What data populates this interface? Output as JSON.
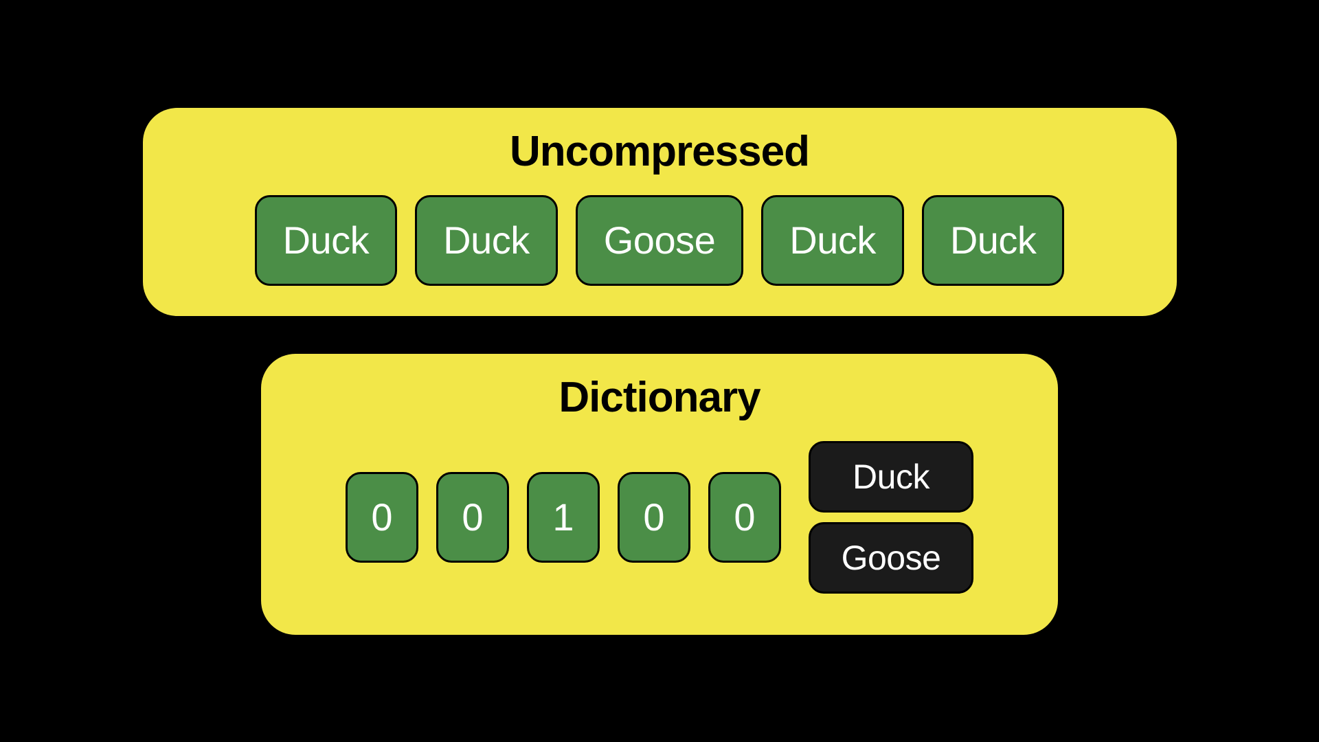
{
  "uncompressed": {
    "title": "Uncompressed",
    "items": [
      "Duck",
      "Duck",
      "Goose",
      "Duck",
      "Duck"
    ]
  },
  "dictionary": {
    "title": "Dictionary",
    "codes": [
      "0",
      "0",
      "1",
      "0",
      "0"
    ],
    "values": [
      "Duck",
      "Goose"
    ]
  }
}
